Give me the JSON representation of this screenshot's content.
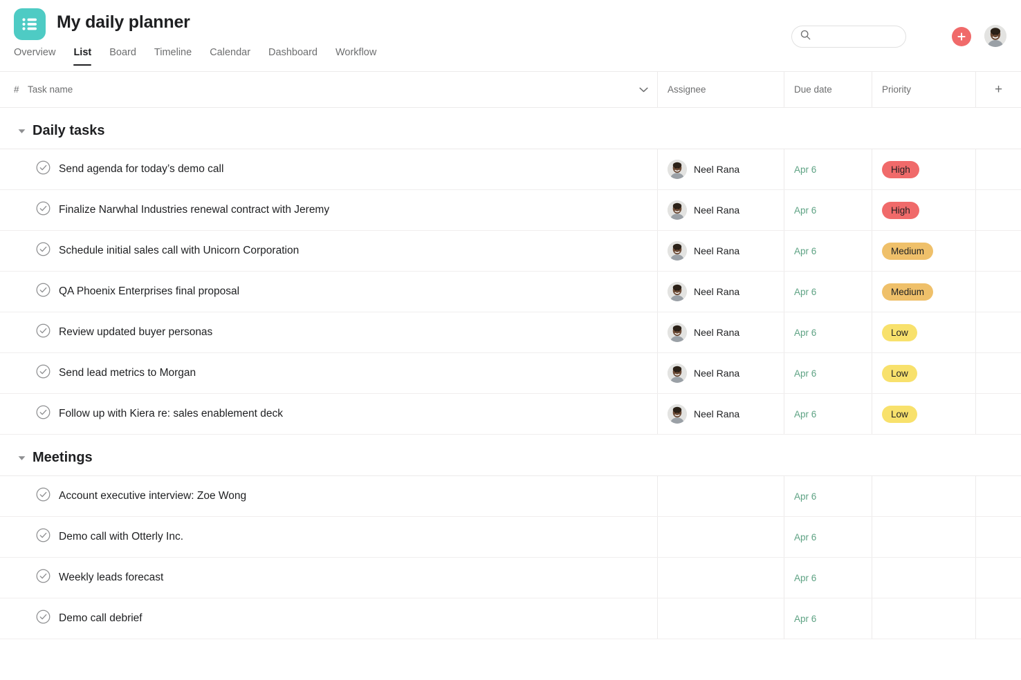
{
  "header": {
    "project_icon": "list-icon",
    "icon_color": "#4ecbc4",
    "title": "My daily planner",
    "tabs": [
      {
        "label": "Overview",
        "active": false
      },
      {
        "label": "List",
        "active": true
      },
      {
        "label": "Board",
        "active": false
      },
      {
        "label": "Timeline",
        "active": false
      },
      {
        "label": "Calendar",
        "active": false
      },
      {
        "label": "Dashboard",
        "active": false
      },
      {
        "label": "Workflow",
        "active": false
      }
    ],
    "search": {
      "icon": "search-icon",
      "value": "",
      "placeholder": ""
    },
    "add_button": {
      "icon": "plus-icon",
      "color": "#f06a6a"
    },
    "avatar": {
      "icon": "user-avatar"
    }
  },
  "columns": {
    "hash": "#",
    "task_name": "Task name",
    "sort_caret": "chevron-down-icon",
    "assignee": "Assignee",
    "due_date": "Due date",
    "priority": "Priority",
    "add_column": "+"
  },
  "priority_colors": {
    "High": "#f06a6a",
    "Medium": "#efc06a",
    "Low": "#f8e16c"
  },
  "sections": [
    {
      "title": "Daily tasks",
      "collapsed": false,
      "tasks": [
        {
          "name": "Send agenda for today’s demo call",
          "assignee": "Neel Rana",
          "due_date": "Apr 6",
          "priority": "High"
        },
        {
          "name": "Finalize Narwhal Industries renewal contract with Jeremy",
          "assignee": "Neel Rana",
          "due_date": "Apr 6",
          "priority": "High"
        },
        {
          "name": "Schedule initial sales call with Unicorn Corporation",
          "assignee": "Neel Rana",
          "due_date": "Apr 6",
          "priority": "Medium"
        },
        {
          "name": "QA Phoenix Enterprises final proposal",
          "assignee": "Neel Rana",
          "due_date": "Apr 6",
          "priority": "Medium"
        },
        {
          "name": "Review updated buyer personas",
          "assignee": "Neel Rana",
          "due_date": "Apr 6",
          "priority": "Low"
        },
        {
          "name": "Send lead metrics to Morgan",
          "assignee": "Neel Rana",
          "due_date": "Apr 6",
          "priority": "Low"
        },
        {
          "name": "Follow up with Kiera re: sales enablement deck",
          "assignee": "Neel Rana",
          "due_date": "Apr 6",
          "priority": "Low"
        }
      ]
    },
    {
      "title": "Meetings",
      "collapsed": false,
      "tasks": [
        {
          "name": "Account executive interview: Zoe Wong",
          "assignee": "",
          "due_date": "Apr 6",
          "priority": ""
        },
        {
          "name": "Demo call with Otterly Inc.",
          "assignee": "",
          "due_date": "Apr 6",
          "priority": ""
        },
        {
          "name": "Weekly leads forecast",
          "assignee": "",
          "due_date": "Apr 6",
          "priority": ""
        },
        {
          "name": "Demo call debrief",
          "assignee": "",
          "due_date": "Apr 6",
          "priority": ""
        }
      ]
    }
  ]
}
